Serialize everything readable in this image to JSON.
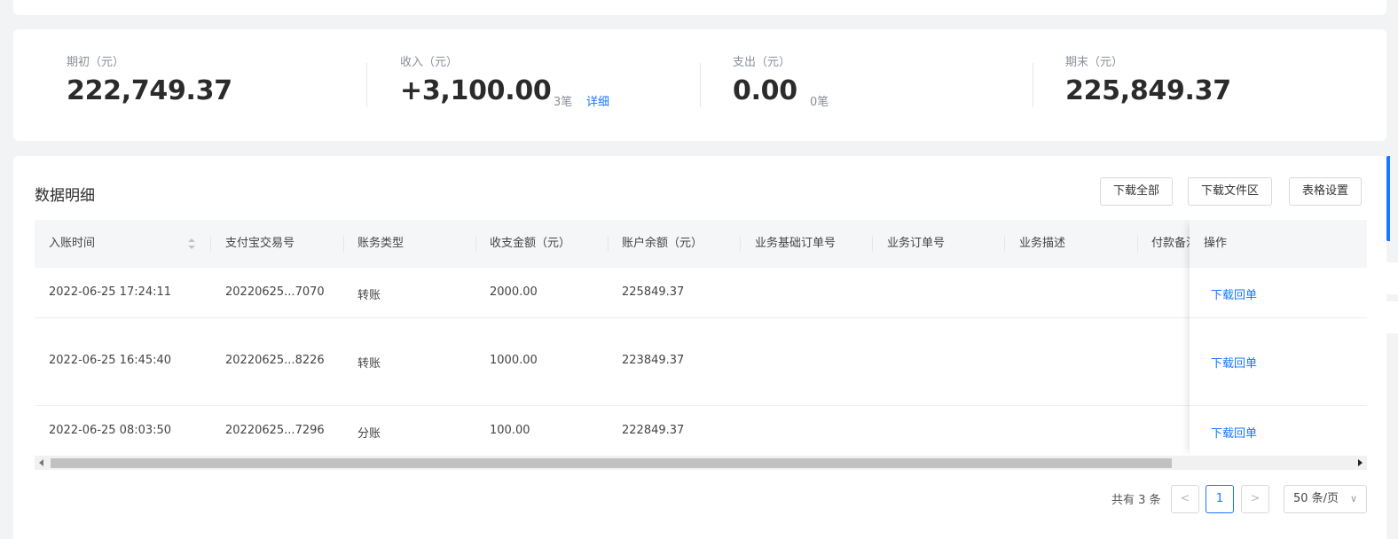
{
  "summary": {
    "opening": {
      "label": "期初（元）",
      "value": "222,749.37"
    },
    "income": {
      "label": "收入（元）",
      "value": "+3,100.00",
      "count": "3笔",
      "link": "详细"
    },
    "expense": {
      "label": "支出（元）",
      "value": "0.00",
      "count": "0笔"
    },
    "closing": {
      "label": "期末（元）",
      "value": "225,849.37"
    }
  },
  "detail": {
    "title": "数据明细",
    "buttons": {
      "download_all": "下载全部",
      "download_center": "下载文件区",
      "table_settings": "表格设置"
    }
  },
  "table": {
    "columns": [
      "入账时间",
      "支付宝交易号",
      "账务类型",
      "收支金额（元）",
      "账户余额（元）",
      "业务基础订单号",
      "业务订单号",
      "业务描述",
      "付款备注",
      "操作"
    ],
    "rows": [
      {
        "time": "2022-06-25 17:24:11",
        "trade_no": "20220625...7070",
        "type": "转账",
        "amount": "2000.00",
        "balance": "225849.37",
        "action": "下载回单"
      },
      {
        "time": "2022-06-25 16:45:40",
        "trade_no": "20220625...8226",
        "type": "转账",
        "amount": "1000.00",
        "balance": "223849.37",
        "action": "下载回单"
      },
      {
        "time": "2022-06-25 08:03:50",
        "trade_no": "20220625...7296",
        "type": "分账",
        "amount": "100.00",
        "balance": "222849.37",
        "action": "下载回单"
      }
    ]
  },
  "pagination": {
    "total": "共有 3 条",
    "prev": "<",
    "current": "1",
    "next": ">",
    "page_size": "50 条/页",
    "page_size_chevron": "∨"
  },
  "colors": {
    "accent": "#1677ff",
    "background": "#f2f3f5",
    "header_bg": "#f5f6f8"
  }
}
